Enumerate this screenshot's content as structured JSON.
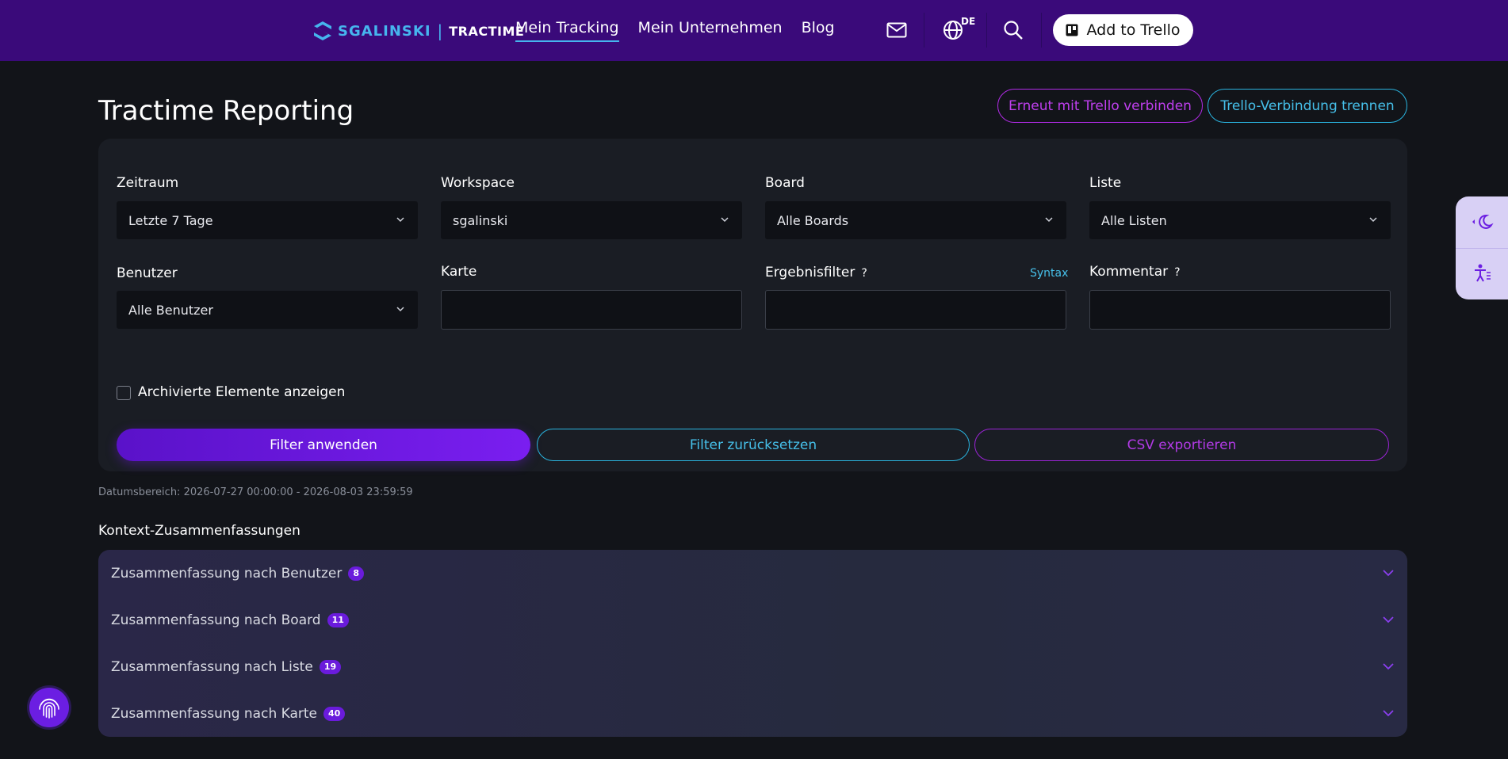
{
  "header": {
    "logo": {
      "brand": "SGALINSKI",
      "separator": "|",
      "product": "TRACTIME"
    },
    "nav": [
      {
        "label": "Mein Tracking",
        "active": true
      },
      {
        "label": "Mein Unternehmen",
        "active": false
      },
      {
        "label": "Blog",
        "active": false
      }
    ],
    "mail_icon": "mail-icon",
    "language": "DE",
    "search_icon": "search-icon",
    "trello_button": "Add to Trello"
  },
  "page": {
    "title": "Tractime Reporting",
    "reconnect_button": "Erneut mit Trello verbinden",
    "disconnect_button": "Trello-Verbindung trennen"
  },
  "filters": {
    "zeitraum": {
      "label": "Zeitraum",
      "value": "Letzte 7 Tage"
    },
    "workspace": {
      "label": "Workspace",
      "value": "sgalinski"
    },
    "board": {
      "label": "Board",
      "value": "Alle Boards"
    },
    "liste": {
      "label": "Liste",
      "value": "Alle Listen"
    },
    "benutzer": {
      "label": "Benutzer",
      "value": "Alle Benutzer"
    },
    "karte": {
      "label": "Karte",
      "value": ""
    },
    "ergebnisfilter": {
      "label": "Ergebnisfilter",
      "help": "?",
      "syntax_link": "Syntax",
      "value": ""
    },
    "kommentar": {
      "label": "Kommentar",
      "help": "?",
      "value": ""
    },
    "archived": {
      "label": "Archivierte Elemente anzeigen",
      "checked": false
    },
    "apply_button": "Filter anwenden",
    "reset_button": "Filter zurücksetzen",
    "csv_button": "CSV exportieren"
  },
  "date_range": "Datumsbereich: 2026-07-27 00:00:00 - 2026-08-03 23:59:59",
  "summaries": {
    "title": "Kontext-Zusammenfassungen",
    "items": [
      {
        "label": "Zusammenfassung nach Benutzer",
        "count": "8"
      },
      {
        "label": "Zusammenfassung nach Board",
        "count": "11"
      },
      {
        "label": "Zusammenfassung nach Liste",
        "count": "19"
      },
      {
        "label": "Zusammenfassung nach Karte",
        "count": "40"
      }
    ]
  },
  "colors": {
    "header_bg": "#3a0a7a",
    "accent_purple": "#7a1ef0",
    "accent_cyan": "#2ab3de",
    "page_bg": "#121419"
  }
}
